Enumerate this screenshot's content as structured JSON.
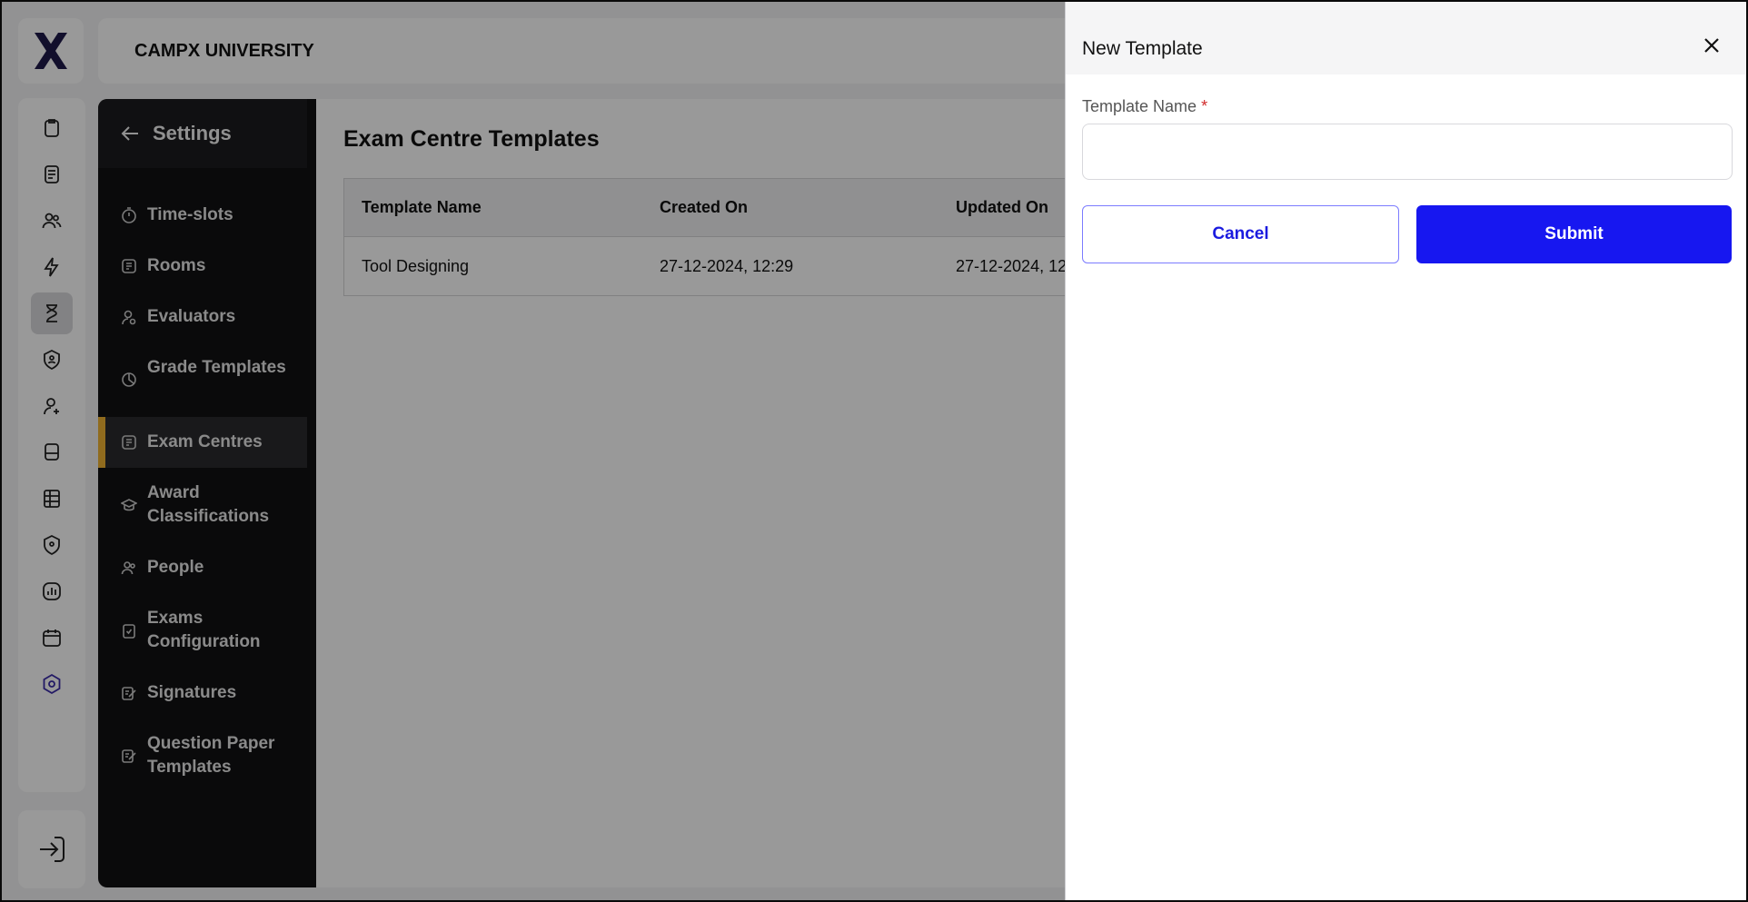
{
  "app": {
    "org_name": "CAMPX UNIVERSITY",
    "accent_color": "#1717f0",
    "active_indicator_color": "#f1b232"
  },
  "rail": {
    "items": [
      {
        "icon": "clipboard-icon"
      },
      {
        "icon": "document-icon"
      },
      {
        "icon": "users-icon"
      },
      {
        "icon": "lightning-icon"
      },
      {
        "icon": "hourglass-icon",
        "active": true
      },
      {
        "icon": "shield-user-icon"
      },
      {
        "icon": "user-add-icon"
      },
      {
        "icon": "bus-icon"
      },
      {
        "icon": "spreadsheet-icon"
      },
      {
        "icon": "shield-location-icon"
      },
      {
        "icon": "chart-icon"
      },
      {
        "icon": "calendar-icon"
      },
      {
        "icon": "settings-hex-icon"
      }
    ],
    "logout_icon": "logout-icon"
  },
  "settings": {
    "back_label": "Settings",
    "items": [
      {
        "label": "Time-slots",
        "icon": "timer-icon"
      },
      {
        "label": "Rooms",
        "icon": "rooms-icon"
      },
      {
        "label": "Evaluators",
        "icon": "evaluator-icon"
      },
      {
        "label": "Grade Templates",
        "icon": "grade-icon"
      },
      {
        "label": "Exam Centres",
        "icon": "building-icon",
        "active": true
      },
      {
        "label": "Award Classifications",
        "icon": "graduation-cap-icon"
      },
      {
        "label": "People",
        "icon": "people-icon"
      },
      {
        "label": "Exams Configuration",
        "icon": "clipboard-check-icon"
      },
      {
        "label": "Signatures",
        "icon": "signature-icon"
      },
      {
        "label": "Question Paper Templates",
        "icon": "signature-icon"
      }
    ]
  },
  "main": {
    "title": "Exam Centre Templates",
    "columns": [
      "Template Name",
      "Created On",
      "Updated On"
    ],
    "rows": [
      [
        "Tool Designing",
        "27-12-2024, 12:29",
        "27-12-2024, 12:"
      ]
    ]
  },
  "drawer": {
    "title": "New Template",
    "field_label": "Template Name",
    "required_mark": "*",
    "field_value": "",
    "cancel_label": "Cancel",
    "submit_label": "Submit"
  }
}
